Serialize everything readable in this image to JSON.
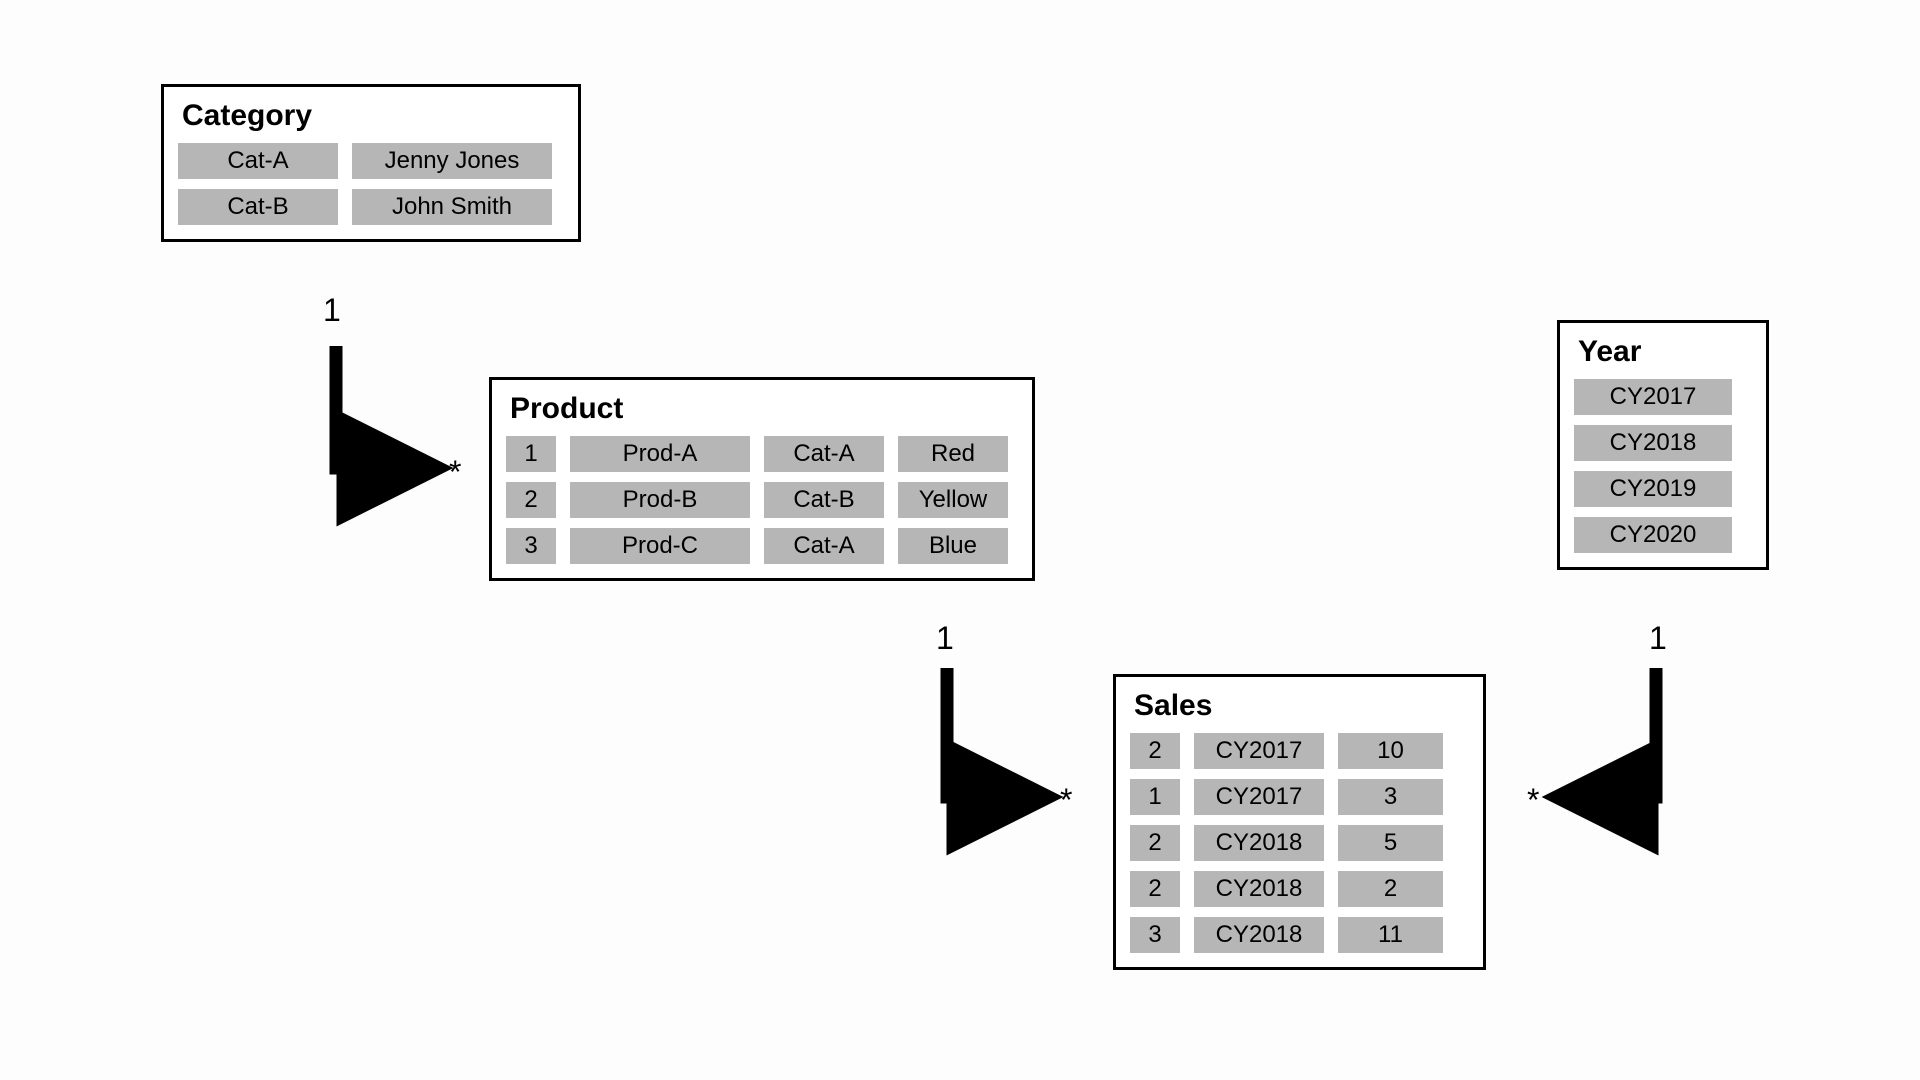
{
  "entities": {
    "category": {
      "title": "Category",
      "rows": [
        [
          "Cat-A",
          "Jenny Jones"
        ],
        [
          "Cat-B",
          "John Smith"
        ]
      ]
    },
    "product": {
      "title": "Product",
      "rows": [
        [
          "1",
          "Prod-A",
          "Cat-A",
          "Red"
        ],
        [
          "2",
          "Prod-B",
          "Cat-B",
          "Yellow"
        ],
        [
          "3",
          "Prod-C",
          "Cat-A",
          "Blue"
        ]
      ]
    },
    "sales": {
      "title": "Sales",
      "rows": [
        [
          "2",
          "CY2017",
          "10"
        ],
        [
          "1",
          "CY2017",
          "3"
        ],
        [
          "2",
          "CY2018",
          "5"
        ],
        [
          "2",
          "CY2018",
          "2"
        ],
        [
          "3",
          "CY2018",
          "11"
        ]
      ]
    },
    "year": {
      "title": "Year",
      "rows": [
        [
          "CY2017"
        ],
        [
          "CY2018"
        ],
        [
          "CY2019"
        ],
        [
          "CY2020"
        ]
      ]
    }
  },
  "cardinalities": {
    "cat_one": "1",
    "prod_many": "*",
    "prod_one": "1",
    "sales_many_left": "*",
    "year_one": "1",
    "sales_many_right": "*"
  }
}
